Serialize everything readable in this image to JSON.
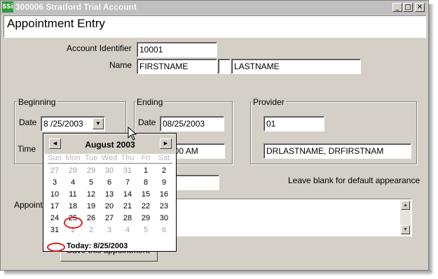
{
  "window": {
    "app_icon_text": "SSi",
    "title": "300006 Stratford Trial Account",
    "min_glyph": "_",
    "max_glyph": "□",
    "close_glyph": "✕"
  },
  "header": {
    "title": "Appointment Entry"
  },
  "account": {
    "label": "Account Identifier",
    "value": "10001",
    "name_label": "Name",
    "first_name": "FIRSTNAME",
    "middle": "",
    "last_name": "LASTNAME"
  },
  "beginning": {
    "group_label": "Beginning",
    "date_label": "Date",
    "date_value": "8 /25/2003",
    "time_label": "Time"
  },
  "ending": {
    "group_label": "Ending",
    "date_label": "Date",
    "date_value": "08/25/2003",
    "time_value": "23:00 AM"
  },
  "provider": {
    "group_label": "Provider",
    "code": "01",
    "name": "DRLASTNAME, DRFIRSTNAM"
  },
  "appearance_hint": "Leave blank for default appearance",
  "appointment_label": "Appoint",
  "save_button": "Save this appointment",
  "calendar": {
    "month_label": "August 2003",
    "weekdays": [
      "Sun",
      "Mon",
      "Tue",
      "Wed",
      "Thu",
      "Fri",
      "Sat"
    ],
    "weeks": [
      [
        {
          "d": "27",
          "o": true
        },
        {
          "d": "28",
          "o": true
        },
        {
          "d": "29",
          "o": true
        },
        {
          "d": "30",
          "o": true
        },
        {
          "d": "31",
          "o": true
        },
        {
          "d": "1",
          "o": false
        },
        {
          "d": "2",
          "o": false
        }
      ],
      [
        {
          "d": "3",
          "o": false
        },
        {
          "d": "4",
          "o": false
        },
        {
          "d": "5",
          "o": false
        },
        {
          "d": "6",
          "o": false
        },
        {
          "d": "7",
          "o": false
        },
        {
          "d": "8",
          "o": false
        },
        {
          "d": "9",
          "o": false
        }
      ],
      [
        {
          "d": "10",
          "o": false
        },
        {
          "d": "11",
          "o": false
        },
        {
          "d": "12",
          "o": false
        },
        {
          "d": "13",
          "o": false
        },
        {
          "d": "14",
          "o": false
        },
        {
          "d": "15",
          "o": false
        },
        {
          "d": "16",
          "o": false
        }
      ],
      [
        {
          "d": "17",
          "o": false
        },
        {
          "d": "18",
          "o": false
        },
        {
          "d": "19",
          "o": false
        },
        {
          "d": "20",
          "o": false
        },
        {
          "d": "21",
          "o": false
        },
        {
          "d": "22",
          "o": false
        },
        {
          "d": "23",
          "o": false
        }
      ],
      [
        {
          "d": "24",
          "o": false
        },
        {
          "d": "25",
          "o": false
        },
        {
          "d": "26",
          "o": false
        },
        {
          "d": "27",
          "o": false
        },
        {
          "d": "28",
          "o": false
        },
        {
          "d": "29",
          "o": false
        },
        {
          "d": "30",
          "o": false
        }
      ],
      [
        {
          "d": "31",
          "o": false
        },
        {
          "d": "1",
          "o": true
        },
        {
          "d": "2",
          "o": true
        },
        {
          "d": "3",
          "o": true
        },
        {
          "d": "4",
          "o": true
        },
        {
          "d": "5",
          "o": true
        },
        {
          "d": "6",
          "o": true
        }
      ]
    ],
    "selected_day": "25",
    "today_label": "Today: 8/25/2003"
  },
  "colors": {
    "face": "#d4d0c8",
    "circle": "#d81f1f",
    "muted_day": "#a0a0a0",
    "weekday_header": "#b8b8b8"
  },
  "icons": {
    "app": "ssi-logo-icon",
    "prev": "triangle-left-icon",
    "next": "triangle-right-icon",
    "dropdown": "triangle-down-icon",
    "cursor": "mouse-pointer-icon"
  }
}
